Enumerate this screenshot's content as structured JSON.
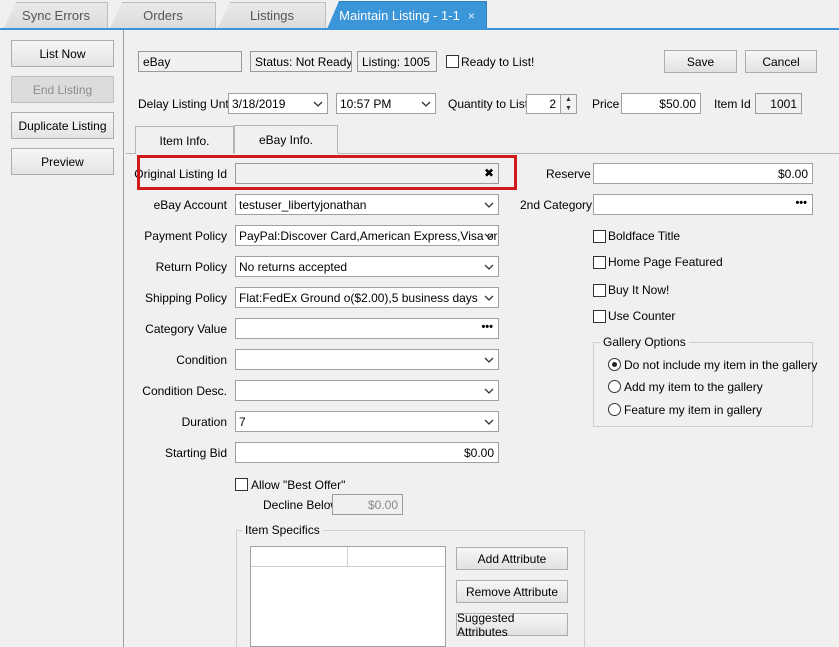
{
  "tabs": [
    {
      "label": "Sync Errors"
    },
    {
      "label": "Orders"
    },
    {
      "label": "Listings"
    },
    {
      "label": "Maintain Listing - 1-1",
      "close": "×"
    }
  ],
  "actions": {
    "list_now": "List Now",
    "end_listing": "End Listing",
    "duplicate_listing": "Duplicate Listing",
    "preview": "Preview"
  },
  "header": {
    "channel": "eBay",
    "status": "Status: Not Ready",
    "listing": "Listing: 1005",
    "ready_to_list": "Ready to List!",
    "save": "Save",
    "cancel": "Cancel"
  },
  "delay": {
    "label": "Delay Listing Until",
    "date": "3/18/2019",
    "time": "10:57 PM",
    "qty_label": "Quantity to List",
    "qty": "2",
    "price_label": "Price",
    "price": "$50.00",
    "item_id_label": "Item Id",
    "item_id": "1001"
  },
  "subtabs": {
    "item_info": "Item Info.",
    "ebay_info": "eBay Info."
  },
  "form": {
    "original_listing_label": "Original Listing Id",
    "original_listing_value": "",
    "clear_glyph": "✖",
    "ebay_account_label": "eBay Account",
    "ebay_account": "testuser_libertyjonathan",
    "payment_policy_label": "Payment Policy",
    "payment_policy": "PayPal:Discover Card,American Express,Visa or",
    "return_policy_label": "Return Policy",
    "return_policy": "No returns accepted",
    "shipping_policy_label": "Shipping Policy",
    "shipping_policy": "Flat:FedEx Ground o($2.00),5 business days",
    "category_value_label": "Category Value",
    "category_value": "",
    "condition_label": "Condition",
    "condition": "",
    "condition_desc_label": "Condition Desc.",
    "condition_desc": "",
    "duration_label": "Duration",
    "duration": "7",
    "starting_bid_label": "Starting Bid",
    "starting_bid": "$0.00",
    "allow_best_offer": "Allow \"Best Offer\"",
    "decline_below_label": "Decline Below",
    "decline_below": "$0.00",
    "ellipsis": "•••"
  },
  "right": {
    "reserve_label": "Reserve",
    "reserve": "$0.00",
    "second_category_label": "2nd Category",
    "second_category": "",
    "boldface": "Boldface Title",
    "home_page": "Home Page Featured",
    "buy_it_now": "Buy It Now!",
    "use_counter": "Use Counter",
    "gallery_title": "Gallery Options",
    "gallery_opt1": "Do not include my item in the gallery",
    "gallery_opt2": "Add my item to the gallery",
    "gallery_opt3": "Feature my item in gallery"
  },
  "specifics": {
    "title": "Item Specifics",
    "add": "Add Attribute",
    "remove": "Remove Attribute",
    "suggested": "Suggested Attributes"
  },
  "colors": {
    "tab_active": "#3b95d9",
    "highlight": "#d11a1a"
  }
}
